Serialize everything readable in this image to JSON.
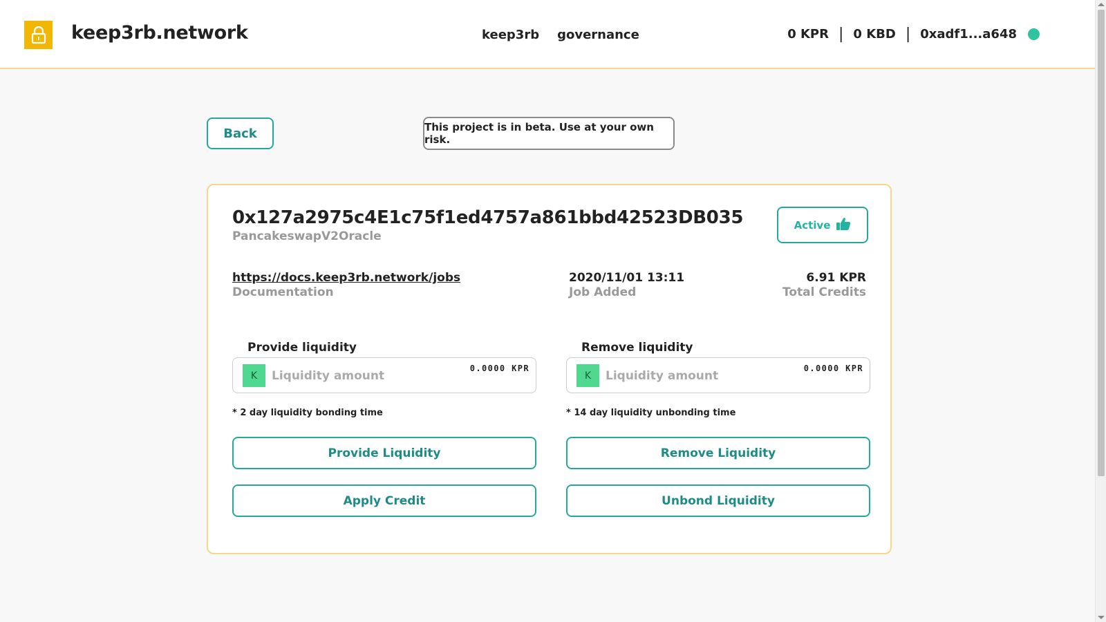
{
  "header": {
    "brand": "keep3rb.network",
    "logo_icon": "lock-icon",
    "nav": [
      "keep3rb",
      "governance"
    ],
    "balances": {
      "kpr": "0 KPR",
      "kbd": "0 KBD",
      "account": "0xadf1...a648"
    },
    "status_color": "#2ec4a0"
  },
  "back_label": "Back",
  "beta_notice": "This project is in beta. Use at your own risk.",
  "job": {
    "address": "0x127a2975c4E1c75f1ed4757a861bbd42523DB035",
    "name": "PancakeswapV2Oracle",
    "status": "Active",
    "status_icon": "thumbs-up-icon",
    "docs_url": "https://docs.keep3rb.network/jobs",
    "docs_label": "Documentation",
    "added_date": "2020/11/01 13:11",
    "added_label": "Job Added",
    "credits": "6.91 KPR",
    "credits_label": "Total Credits"
  },
  "provide": {
    "title": "Provide liquidity",
    "token_letter": "K",
    "placeholder": "Liquidity amount",
    "balance": "0.0000 KPR",
    "note": "* 2 day liquidity bonding time",
    "primary_button": "Provide Liquidity",
    "secondary_button": "Apply Credit"
  },
  "remove": {
    "title": "Remove liquidity",
    "token_letter": "K",
    "placeholder": "Liquidity amount",
    "balance": "0.0000 KPR",
    "note": "* 14 day liquidity unbonding time",
    "primary_button": "Remove Liquidity",
    "secondary_button": "Unbond Liquidity"
  },
  "colors": {
    "accent_teal": "#23a99a",
    "brand_yellow": "#f2b705",
    "card_border": "#f6d88a",
    "token_green": "#4fd88e"
  }
}
